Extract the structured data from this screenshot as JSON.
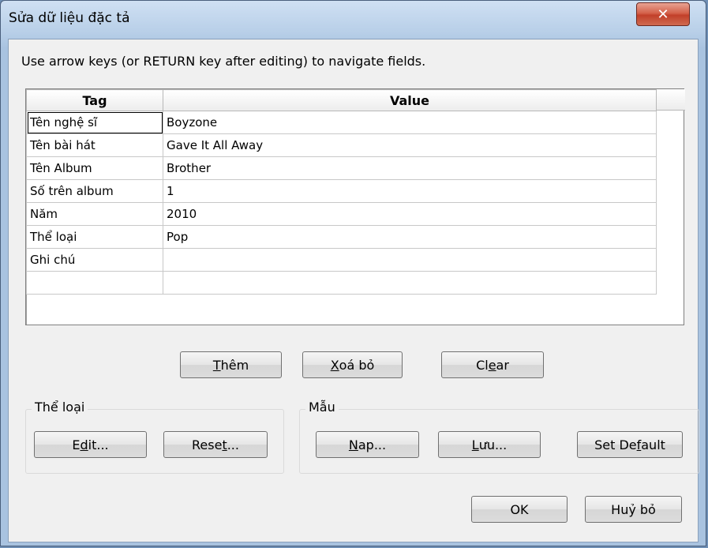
{
  "window": {
    "title": "Sửa dữ liệu đặc tả",
    "close_glyph": "✕"
  },
  "instruction": "Use arrow keys (or RETURN key after editing) to navigate fields.",
  "table": {
    "columns": [
      "Tag",
      "Value"
    ],
    "rows": [
      {
        "tag": "Tên nghệ sĩ",
        "value": "Boyzone"
      },
      {
        "tag": "Tên bài hát",
        "value": "Gave It All Away"
      },
      {
        "tag": "Tên Album",
        "value": "Brother"
      },
      {
        "tag": "Số trên album",
        "value": "1"
      },
      {
        "tag": "Năm",
        "value": "2010"
      },
      {
        "tag": "Thể loại",
        "value": "Pop"
      },
      {
        "tag": "Ghi chú",
        "value": ""
      },
      {
        "tag": "",
        "value": ""
      }
    ]
  },
  "row_buttons": {
    "add": {
      "pre": "",
      "key": "T",
      "post": "hêm"
    },
    "delete": {
      "pre": "",
      "key": "X",
      "post": "oá bỏ"
    },
    "clear": {
      "pre": "Cl",
      "key": "e",
      "post": "ar"
    }
  },
  "genre_group": {
    "label": "Thể loại",
    "edit": {
      "pre": "E",
      "key": "d",
      "post": "it..."
    },
    "reset": {
      "pre": "Rese",
      "key": "t",
      "post": "..."
    }
  },
  "template_group": {
    "label": "Mẫu",
    "load": {
      "pre": "",
      "key": "N",
      "post": "ap..."
    },
    "save": {
      "pre": "",
      "key": "L",
      "post": "ưu..."
    },
    "set_default": {
      "pre": "Set De",
      "key": "f",
      "post": "ault"
    }
  },
  "footer": {
    "ok": "OK",
    "cancel": "Huỷ bỏ"
  }
}
